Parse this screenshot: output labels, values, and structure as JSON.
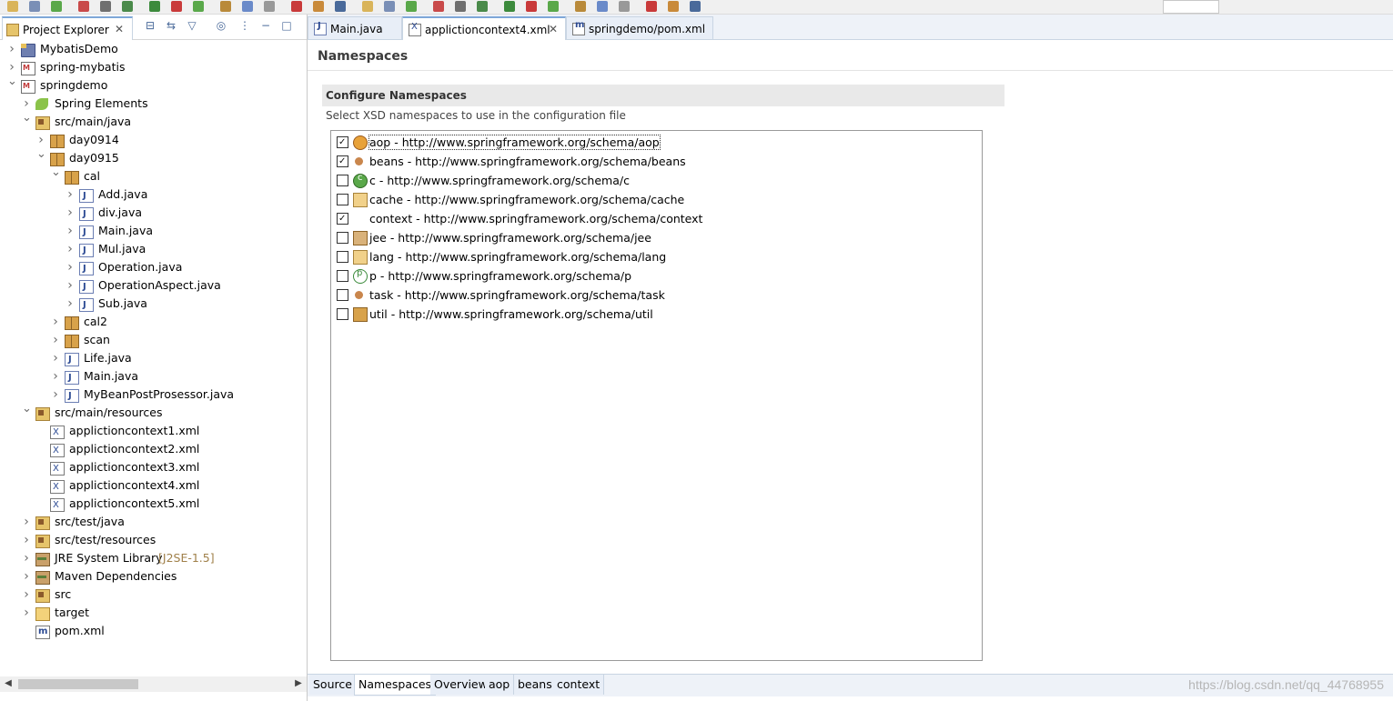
{
  "project_explorer": {
    "title": "Project Explorer",
    "close_symbol": "✕"
  },
  "tree": [
    {
      "label": "MybatisDemo",
      "icon": "project-icon",
      "level": 0,
      "expand": "collapsed"
    },
    {
      "label": "spring-mybatis",
      "icon": "maven-project-icon",
      "level": 0,
      "expand": "collapsed"
    },
    {
      "label": "springdemo",
      "icon": "maven-project-icon",
      "level": 0,
      "expand": "expanded"
    },
    {
      "label": "Spring Elements",
      "icon": "spring-leaf-icon",
      "level": 1,
      "expand": "collapsed"
    },
    {
      "label": "src/main/java",
      "icon": "source-folder-icon",
      "level": 1,
      "expand": "expanded"
    },
    {
      "label": "day0914",
      "icon": "package-icon",
      "level": 2,
      "expand": "collapsed"
    },
    {
      "label": "day0915",
      "icon": "package-icon",
      "level": 2,
      "expand": "expanded"
    },
    {
      "label": "cal",
      "icon": "package-icon",
      "level": 3,
      "expand": "expanded"
    },
    {
      "label": "Add.java",
      "icon": "java-file-icon",
      "level": 4,
      "expand": "collapsed"
    },
    {
      "label": "div.java",
      "icon": "java-file-icon",
      "level": 4,
      "expand": "collapsed"
    },
    {
      "label": "Main.java",
      "icon": "java-file-icon",
      "level": 4,
      "expand": "collapsed"
    },
    {
      "label": "Mul.java",
      "icon": "java-file-icon",
      "level": 4,
      "expand": "collapsed"
    },
    {
      "label": "Operation.java",
      "icon": "java-file-icon",
      "level": 4,
      "expand": "collapsed"
    },
    {
      "label": "OperationAspect.java",
      "icon": "java-file-icon",
      "level": 4,
      "expand": "collapsed"
    },
    {
      "label": "Sub.java",
      "icon": "java-file-icon",
      "level": 4,
      "expand": "collapsed"
    },
    {
      "label": "cal2",
      "icon": "package-icon",
      "level": 3,
      "expand": "collapsed"
    },
    {
      "label": "scan",
      "icon": "package-icon",
      "level": 3,
      "expand": "collapsed"
    },
    {
      "label": "Life.java",
      "icon": "java-file-icon",
      "level": 3,
      "expand": "collapsed"
    },
    {
      "label": "Main.java",
      "icon": "java-file-icon",
      "level": 3,
      "expand": "collapsed"
    },
    {
      "label": "MyBeanPostProsessor.java",
      "icon": "java-file-icon",
      "level": 3,
      "expand": "collapsed"
    },
    {
      "label": "src/main/resources",
      "icon": "source-folder-icon",
      "level": 1,
      "expand": "expanded"
    },
    {
      "label": "applictioncontext1.xml",
      "icon": "xml-file-icon",
      "level": 2,
      "expand": "none"
    },
    {
      "label": "applictioncontext2.xml",
      "icon": "xml-file-icon",
      "level": 2,
      "expand": "none"
    },
    {
      "label": "applictioncontext3.xml",
      "icon": "xml-file-icon",
      "level": 2,
      "expand": "none"
    },
    {
      "label": "applictioncontext4.xml",
      "icon": "xml-file-icon",
      "level": 2,
      "expand": "none"
    },
    {
      "label": "applictioncontext5.xml",
      "icon": "xml-file-icon",
      "level": 2,
      "expand": "none"
    },
    {
      "label": "src/test/java",
      "icon": "source-folder-icon",
      "level": 1,
      "expand": "collapsed"
    },
    {
      "label": "src/test/resources",
      "icon": "source-folder-icon",
      "level": 1,
      "expand": "collapsed"
    },
    {
      "label": "JRE System Library",
      "decoration": "[J2SE-1.5]",
      "icon": "library-icon",
      "level": 1,
      "expand": "collapsed"
    },
    {
      "label": "Maven Dependencies",
      "icon": "library-icon",
      "level": 1,
      "expand": "collapsed"
    },
    {
      "label": "src",
      "icon": "source-folder-icon",
      "level": 1,
      "expand": "collapsed"
    },
    {
      "label": "target",
      "icon": "folder-icon",
      "level": 1,
      "expand": "collapsed"
    },
    {
      "label": "pom.xml",
      "icon": "pom-file-icon",
      "level": 1,
      "expand": "none"
    }
  ],
  "editor_tabs": [
    {
      "label": "Main.java",
      "icon": "java-file-icon",
      "active": false
    },
    {
      "label": "applictioncontext4.xml",
      "icon": "xml-file-icon",
      "active": true,
      "close_symbol": "✕"
    },
    {
      "label": "springdemo/pom.xml",
      "icon": "pom-file-icon",
      "active": false
    }
  ],
  "namespaces_page": {
    "title": "Namespaces",
    "section_title": "Configure Namespaces",
    "section_description": "Select XSD namespaces to use in the configuration file",
    "items": [
      {
        "label": "aop - http://www.springframework.org/schema/aop",
        "checked": true,
        "icon": "aop-icon",
        "selected": true
      },
      {
        "label": "beans - http://www.springframework.org/schema/beans",
        "checked": true,
        "icon": "beans-icon",
        "selected": false
      },
      {
        "label": "c - http://www.springframework.org/schema/c",
        "checked": false,
        "icon": "c-icon",
        "selected": false
      },
      {
        "label": "cache - http://www.springframework.org/schema/cache",
        "checked": false,
        "icon": "cache-icon",
        "selected": false
      },
      {
        "label": "context - http://www.springframework.org/schema/context",
        "checked": true,
        "icon": "context-icon",
        "selected": false
      },
      {
        "label": "jee - http://www.springframework.org/schema/jee",
        "checked": false,
        "icon": "jee-icon",
        "selected": false
      },
      {
        "label": "lang - http://www.springframework.org/schema/lang",
        "checked": false,
        "icon": "lang-icon",
        "selected": false
      },
      {
        "label": "p - http://www.springframework.org/schema/p",
        "checked": false,
        "icon": "p-icon",
        "selected": false
      },
      {
        "label": "task - http://www.springframework.org/schema/task",
        "checked": false,
        "icon": "task-icon",
        "selected": false
      },
      {
        "label": "util - http://www.springframework.org/schema/util",
        "checked": false,
        "icon": "util-icon",
        "selected": false
      }
    ]
  },
  "bottom_tabs": [
    {
      "label": "Source",
      "active": false
    },
    {
      "label": "Namespaces",
      "active": true
    },
    {
      "label": "Overview",
      "active": false
    },
    {
      "label": "aop",
      "active": false
    },
    {
      "label": "beans",
      "active": false
    },
    {
      "label": "context",
      "active": false
    }
  ],
  "watermark": "https://blog.csdn.net/qq_44768955",
  "colors": {
    "active_tab_border": "#7ea7d8",
    "tab_background": "#e8eef7",
    "section_background": "#e9e9e9"
  }
}
